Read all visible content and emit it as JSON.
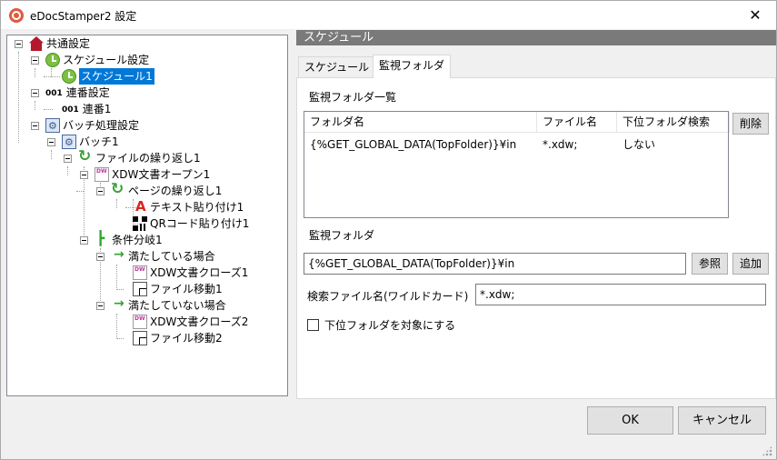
{
  "window": {
    "title": "eDocStamper2 設定"
  },
  "tree": {
    "common": "共通設定",
    "schedule_settings": "スケジュール設定",
    "schedule1": "スケジュール1",
    "serial_settings": "連番設定",
    "serial1": "連番1",
    "serial_icon": "001",
    "batch_settings": "バッチ処理設定",
    "batch1": "バッチ1",
    "file_loop1": "ファイルの繰り返し1",
    "xdw_open1": "XDW文書オープン1",
    "page_loop1": "ページの繰り返し1",
    "text_paste1": "テキスト貼り付け1",
    "qr_paste1": "QRコード貼り付け1",
    "condition1": "条件分岐1",
    "satisfied": "満たしている場合",
    "xdw_close1": "XDW文書クローズ1",
    "file_move1": "ファイル移動1",
    "not_satisfied": "満たしていない場合",
    "xdw_close2": "XDW文書クローズ2",
    "file_move2": "ファイル移動2"
  },
  "panel": {
    "header": "スケジュール"
  },
  "tabs": [
    {
      "label": "スケジュール"
    },
    {
      "label": "監視フォルダ"
    }
  ],
  "watch": {
    "list_label": "監視フォルダ一覧",
    "columns": [
      "フォルダ名",
      "ファイル名",
      "下位フォルダ検索"
    ],
    "rows": [
      {
        "folder": "{%GET_GLOBAL_DATA(TopFolder)}¥in",
        "file": "*.xdw;",
        "subfolder": "しない"
      }
    ],
    "delete_button": "削除",
    "folder_label": "監視フォルダ",
    "folder_value": "{%GET_GLOBAL_DATA(TopFolder)}¥in",
    "browse_button": "参照",
    "add_button": "追加",
    "pattern_label": "検索ファイル名(ワイルドカード)",
    "pattern_value": "*.xdw;",
    "subfolder_checkbox_label": "下位フォルダを対象にする",
    "subfolder_checked": false
  },
  "footer": {
    "ok": "OK",
    "cancel": "キャンセル"
  },
  "colors": {
    "selection": "#0078d7",
    "header_bar": "#7a7a7a",
    "window_bg": "#f0f0f0"
  }
}
